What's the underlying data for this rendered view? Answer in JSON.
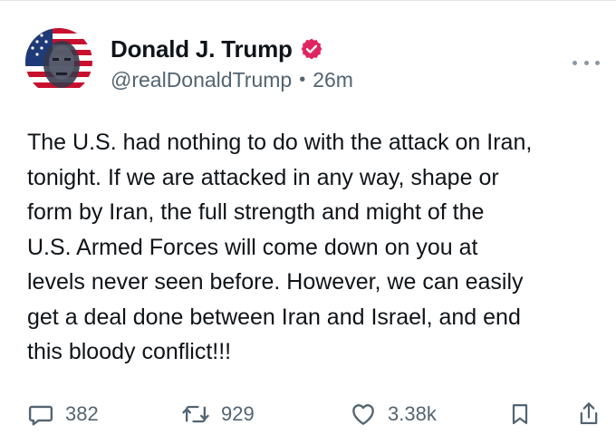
{
  "post": {
    "author": {
      "display_name": "Donald J. Trump",
      "handle": "@realDonaldTrump",
      "verified_icon": "verified-badge-icon",
      "avatar_icon": "avatar-flag-portrait"
    },
    "separator": "•",
    "time_ago": "26m",
    "text": "The U.S. had nothing to do with the attack on Iran,\ntonight. If we are attacked in any way, shape or\nform by Iran, the full strength and might of the\nU.S. Armed Forces will come down on you at\nlevels never seen before. However, we can easily\nget a deal done between Iran and Israel, and end\nthis bloody conflict!!!",
    "actions": {
      "replies": "382",
      "reposts": "929",
      "likes": "3.38k",
      "reply_icon": "reply-icon",
      "repost_icon": "repost-icon",
      "like_icon": "heart-icon",
      "bookmark_icon": "bookmark-icon",
      "share_icon": "share-icon"
    }
  },
  "colors": {
    "text_primary": "#0f1419",
    "text_secondary": "#536471",
    "verified": "#e0245e",
    "divider": "#e6e6e6"
  }
}
